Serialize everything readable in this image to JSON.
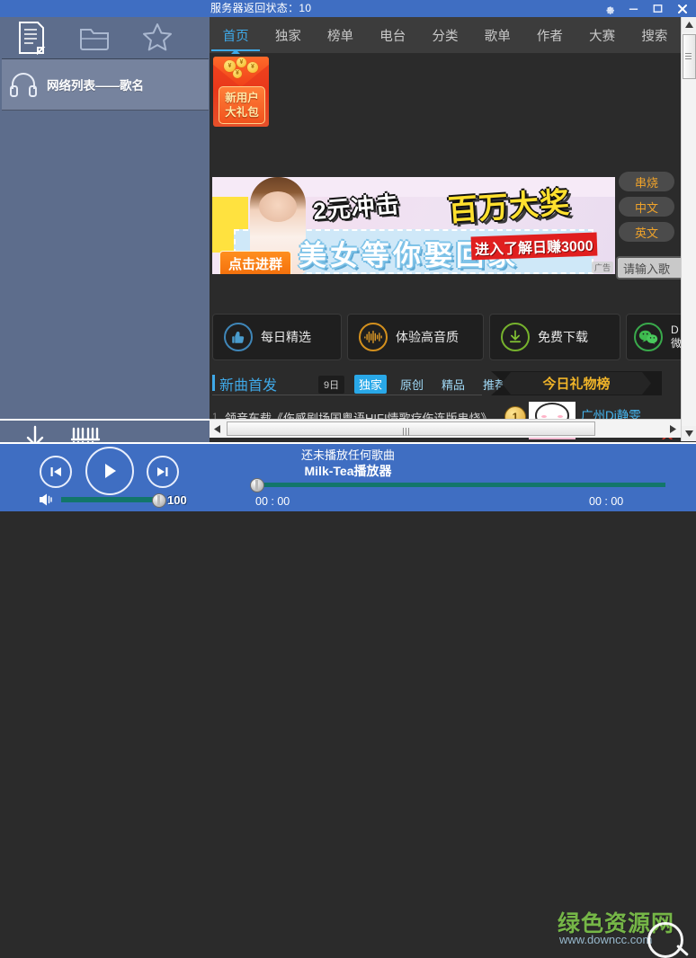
{
  "window": {
    "title": "服务器返回状态：10",
    "controls": {
      "settings": "gear-icon",
      "minimize": "minimize-icon",
      "maximize": "maximize-icon",
      "close": "close-icon"
    }
  },
  "sidebar": {
    "tools": [
      {
        "name": "playlist-icon",
        "label": "播放列表"
      },
      {
        "name": "folder-icon",
        "label": "本地文件夹"
      },
      {
        "name": "star-icon",
        "label": "收藏"
      }
    ],
    "list_header": {
      "icon": "headphone-icon",
      "title": "网络列表——歌名"
    },
    "bottom_tools": [
      {
        "name": "download-icon",
        "label": "下载"
      },
      {
        "name": "equalizer-icon",
        "label": "音效"
      }
    ]
  },
  "nav": {
    "tabs": [
      {
        "label": "首页",
        "active": true
      },
      {
        "label": "独家",
        "active": false
      },
      {
        "label": "榜单",
        "active": false
      },
      {
        "label": "电台",
        "active": false
      },
      {
        "label": "分类",
        "active": false
      },
      {
        "label": "歌单",
        "active": false
      },
      {
        "label": "作者",
        "active": false
      },
      {
        "label": "大赛",
        "active": false
      },
      {
        "label": "搜索",
        "active": false
      }
    ]
  },
  "gift": {
    "line1": "新用户",
    "line2": "大礼包"
  },
  "banner": {
    "headline_left": "2元冲击",
    "headline_right": "百万大奖",
    "subline": "美女等你娶回家",
    "join_button": "点击进群",
    "red_tag": "进入了解日赚3000",
    "ad_label": "广告"
  },
  "side_pills": [
    {
      "label": "串烧"
    },
    {
      "label": "中文"
    },
    {
      "label": "英文"
    }
  ],
  "search": {
    "value": "请输入歌",
    "placeholder": "请输入歌曲名"
  },
  "features": [
    {
      "label": "每日精选",
      "sub": "",
      "icon": "thumbs-up-icon",
      "color": "#4a90c4"
    },
    {
      "label": "体验高音质",
      "sub": "",
      "icon": "waveform-icon",
      "color": "#e09420"
    },
    {
      "label": "免费下载",
      "sub": "",
      "icon": "download-circle-icon",
      "color": "#7cb82f"
    },
    {
      "label": "D",
      "sub": "微",
      "icon": "wechat-icon",
      "color": "#3ebb4f"
    }
  ],
  "section": {
    "title": "新曲首发",
    "badge": "9日",
    "filters": [
      {
        "label": "独家",
        "active": true
      },
      {
        "label": "原创",
        "active": false
      },
      {
        "label": "精品",
        "active": false
      },
      {
        "label": "推荐",
        "active": false
      }
    ],
    "ribbon": "今日礼物榜"
  },
  "song_row": {
    "index": "1",
    "title": "领音车载《伤感剧场国粤语HIFI情歌疗伤连版串烧》",
    "rank": "1",
    "artist": "广州Dj静雯"
  },
  "player": {
    "now_playing": "还未播放任何歌曲",
    "app_name": "Milk-Tea播放器",
    "volume": "100",
    "time_elapsed": "00 : 00",
    "time_total": "00 : 00",
    "buttons": {
      "prev": "previous-track-icon",
      "play": "play-icon",
      "next": "next-track-icon",
      "volume": "volume-icon"
    }
  },
  "watermark": {
    "text": "绿色资源网",
    "url": "www.downcc.com"
  },
  "colors": {
    "accent_blue": "#3f6ec2",
    "link_blue": "#3fa9e8",
    "sidebar": "#5d6d8c",
    "content_bg": "#2b2b2b",
    "slider_green": "#12766a",
    "pill_orange": "#f0a32a"
  }
}
